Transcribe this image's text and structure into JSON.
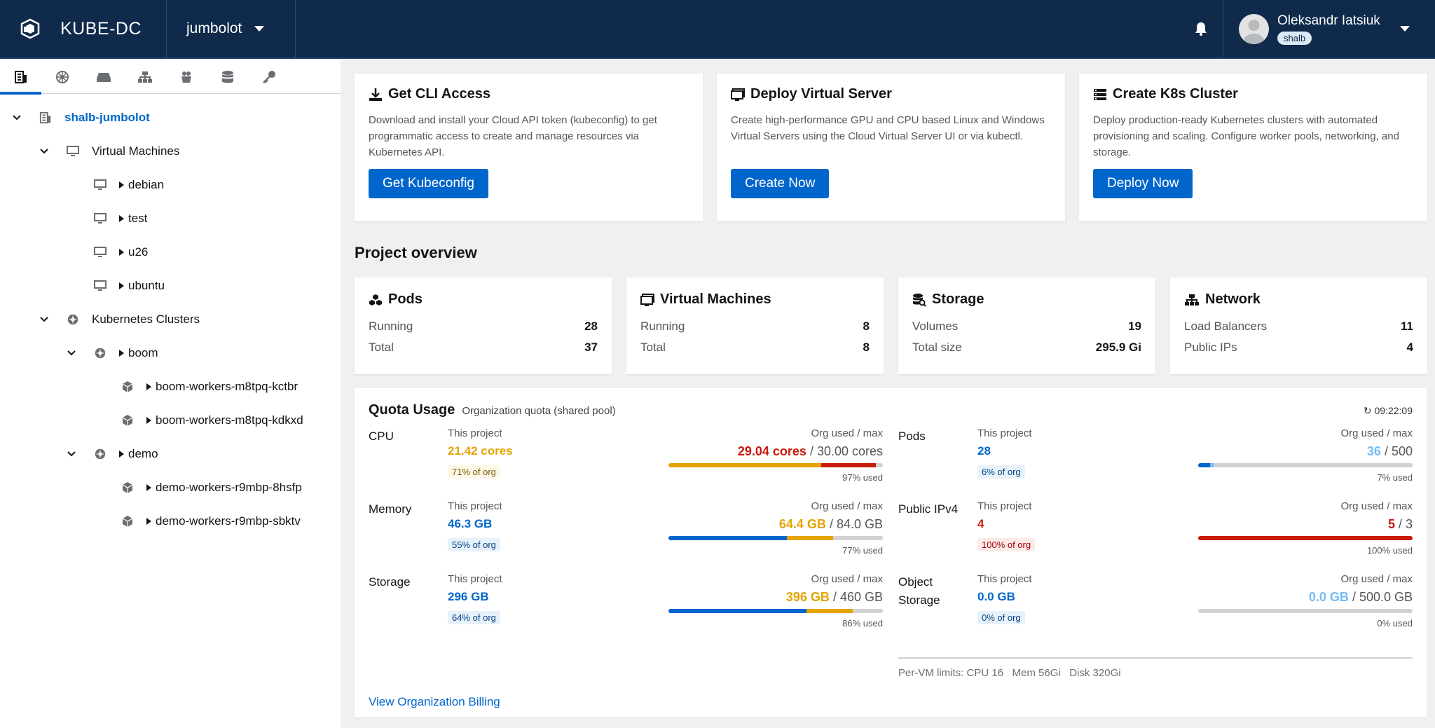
{
  "header": {
    "brand": "KUBE-DC",
    "project": "jumbolot",
    "user_name": "Oleksandr Iatsiuk",
    "user_badge": "shalb"
  },
  "sidebar": {
    "tabs": [
      "projects-icon",
      "kubernetes-icon",
      "servers-icon",
      "network-icon",
      "containers-icon",
      "database-icon",
      "key-icon"
    ],
    "tree": {
      "root": "shalb-jumbolot",
      "vm_group": "Virtual Machines",
      "vms": [
        "debian",
        "test",
        "u26",
        "ubuntu"
      ],
      "k8s_group": "Kubernetes Clusters",
      "clusters": [
        {
          "name": "boom",
          "workers": [
            "boom-workers-m8tpq-kctbr",
            "boom-workers-m8tpq-kdkxd"
          ]
        },
        {
          "name": "demo",
          "workers": [
            "demo-workers-r9mbp-8hsfp",
            "demo-workers-r9mbp-sbktv"
          ]
        }
      ]
    }
  },
  "actions": [
    {
      "title": "Get CLI Access",
      "desc": "Download and install your Cloud API token (kubeconfig) to get programmatic access to create and manage resources via Kubernetes API.",
      "button": "Get Kubeconfig",
      "icon": "download-icon"
    },
    {
      "title": "Deploy Virtual Server",
      "desc": "Create high-performance GPU and CPU based Linux and Windows Virtual Servers using the Cloud Virtual Server UI or via kubectl.",
      "button": "Create Now",
      "icon": "virtual-server-icon"
    },
    {
      "title": "Create K8s Cluster",
      "desc": "Deploy production-ready Kubernetes clusters with automated provisioning and scaling. Configure worker pools, networking, and storage.",
      "button": "Deploy Now",
      "icon": "k8s-cluster-icon"
    }
  ],
  "overview": {
    "title": "Project overview",
    "cards": [
      {
        "title": "Pods",
        "rows": [
          {
            "label": "Running",
            "value": "28"
          },
          {
            "label": "Total",
            "value": "37"
          }
        ]
      },
      {
        "title": "Virtual Machines",
        "rows": [
          {
            "label": "Running",
            "value": "8"
          },
          {
            "label": "Total",
            "value": "8"
          }
        ]
      },
      {
        "title": "Storage",
        "rows": [
          {
            "label": "Volumes",
            "value": "19"
          },
          {
            "label": "Total size",
            "value": "295.9 Gi"
          }
        ]
      },
      {
        "title": "Network",
        "rows": [
          {
            "label": "Load Balancers",
            "value": "11"
          },
          {
            "label": "Public IPs",
            "value": "4"
          }
        ]
      }
    ]
  },
  "quota": {
    "title": "Quota Usage",
    "subtitle": "Organization quota (shared pool)",
    "time": "↻ 09:22:09",
    "project_label": "This project",
    "org_label": "Org used / max",
    "items": [
      {
        "name": "CPU",
        "project_value": "21.42 cores",
        "pill": "71% of org",
        "org_used": "29.04 cores",
        "org_max": "/ 30.00 cores",
        "used": "97% used",
        "project_frac": 0.714,
        "org_frac": 0.968,
        "colors": {
          "project": "#e5a300",
          "value": "#e5a300",
          "org": "#c9190b",
          "pill_bg": "#fdf7e7",
          "pill_fg": "#795600"
        }
      },
      {
        "name": "Memory",
        "project_value": "46.3 GB",
        "pill": "55% of org",
        "org_used": "64.4 GB",
        "org_max": "/ 84.0 GB",
        "used": "77% used",
        "project_frac": 0.551,
        "org_frac": 0.767,
        "colors": {
          "project": "#0066cc",
          "value": "#0066cc",
          "org": "#e5a300",
          "pill_bg": "#e7f1fa",
          "pill_fg": "#004080"
        }
      },
      {
        "name": "Storage",
        "project_value": "296 GB",
        "pill": "64% of org",
        "org_used": "396 GB",
        "org_max": "/ 460 GB",
        "used": "86% used",
        "project_frac": 0.643,
        "org_frac": 0.861,
        "colors": {
          "project": "#0066cc",
          "value": "#0066cc",
          "org": "#e5a300",
          "pill_bg": "#e7f1fa",
          "pill_fg": "#004080"
        }
      },
      {
        "name": "Pods",
        "project_value": "28",
        "pill": "6% of org",
        "org_used": "36",
        "org_max": "/ 500",
        "used": "7% used",
        "project_frac": 0.056,
        "org_frac": 0.072,
        "colors": {
          "project": "#0066cc",
          "value": "#0066cc",
          "org": "#73bcf7",
          "pill_bg": "#e7f1fa",
          "pill_fg": "#004080"
        }
      },
      {
        "name": "Public IPv4",
        "project_value": "4",
        "pill": "100% of org",
        "org_used": "5",
        "org_max": "/ 3",
        "used": "100% used",
        "project_frac": 1.0,
        "org_frac": 1.0,
        "colors": {
          "project": "#c9190b",
          "value": "#c9190b",
          "org": "#c9190b",
          "pill_bg": "#faeae8",
          "pill_fg": "#a30000"
        }
      },
      {
        "name": "Object Storage",
        "project_value": "0.0 GB",
        "pill": "0% of org",
        "org_used": "0.0 GB",
        "org_max": "/ 500.0 GB",
        "used": "0% used",
        "project_frac": 0.0,
        "org_frac": 0.0,
        "colors": {
          "project": "#0066cc",
          "value": "#0066cc",
          "org": "#73bcf7",
          "pill_bg": "#e7f1fa",
          "pill_fg": "#004080"
        }
      }
    ],
    "limits": "Per-VM limits: CPU 16   Mem 56Gi   Disk 320Gi",
    "billing_link": "View Organization Billing"
  },
  "colors": {
    "header_bg": "#0f2a4a",
    "accent": "#0066cc",
    "warning": "#e5a300",
    "danger": "#c9190b"
  }
}
